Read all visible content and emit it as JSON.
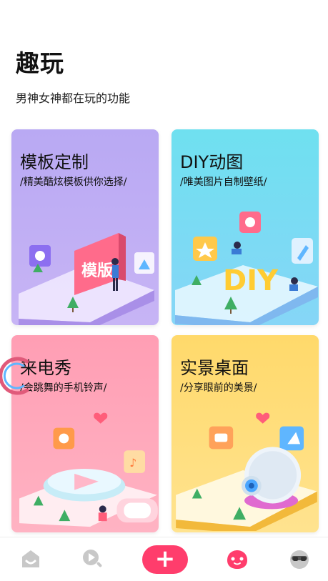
{
  "page": {
    "title": "趣玩",
    "subtitle": "男神女神都在玩的功能"
  },
  "cards": [
    {
      "title": "模板定制",
      "subtitle": "/精美酷炫模板供你选择/",
      "badge_text": "模版"
    },
    {
      "title": "DIY动图",
      "subtitle": "/唯美图片自制壁纸/",
      "badge_text": "DIY"
    },
    {
      "title": "来电秀",
      "subtitle": "/会跳舞的手机铃声/"
    },
    {
      "title": "实景桌面",
      "subtitle": "/分享眼前的美景/"
    }
  ],
  "tabbar": {
    "items": [
      {
        "icon": "home-icon"
      },
      {
        "icon": "video-search-icon"
      },
      {
        "icon": "add-icon"
      },
      {
        "icon": "fun-face-icon"
      },
      {
        "icon": "profile-glasses-icon"
      }
    ],
    "active_color": "#ff3d6c",
    "inactive_color": "#c8c8c8"
  },
  "colors": {
    "card_template": "#b9a9f3",
    "card_diy": "#6fe0f0",
    "card_ringtone": "#ff9eb4",
    "card_scene": "#ffd96b"
  }
}
